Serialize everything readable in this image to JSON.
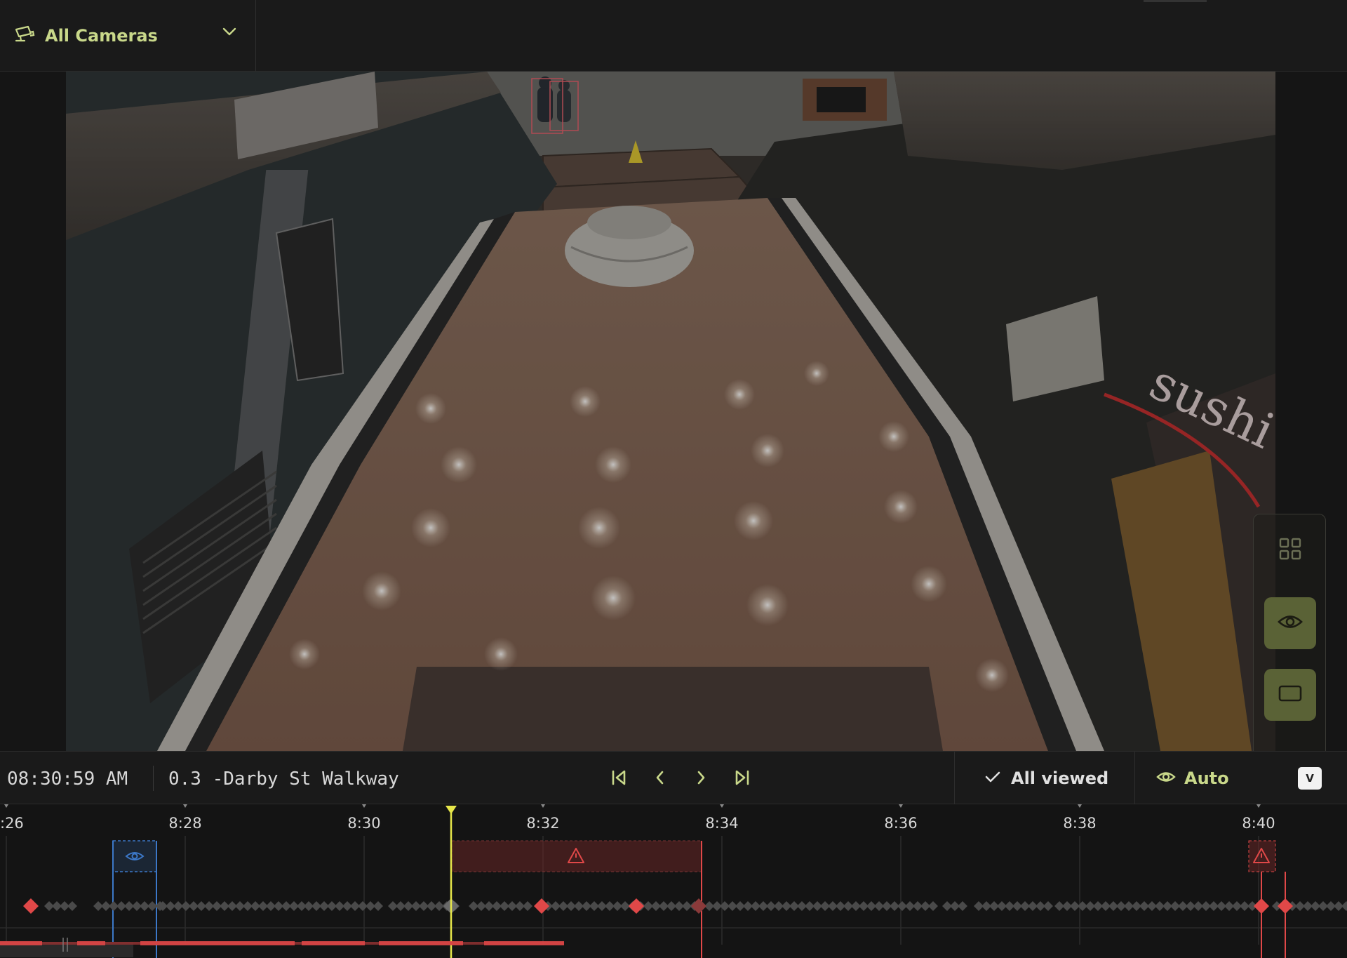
{
  "camera_selector": {
    "label": "All Cameras",
    "icon": "cctv-camera-icon",
    "chevron": "chevron-down-icon"
  },
  "side_tools": [
    {
      "name": "grid-view-icon",
      "active": false
    },
    {
      "name": "eye-icon",
      "active": true
    },
    {
      "name": "single-view-icon",
      "active": true
    },
    {
      "name": "download-icon",
      "active": false
    }
  ],
  "controls": {
    "time": "08:30:59 AM",
    "camera_name": "0.3 -Darby St Walkway",
    "nav": [
      "skip-back-icon",
      "previous-icon",
      "next-icon",
      "skip-forward-icon"
    ],
    "viewed_label": "All viewed",
    "auto_label": "Auto",
    "shortcut_key": "V"
  },
  "timeline": {
    "tick_labels": [
      ":26",
      "8:28",
      "8:30",
      "8:32",
      "8:34",
      "8:36",
      "8:38",
      "8:40"
    ],
    "playhead_time": "8:31",
    "accent_color": "#e6e64a",
    "alert_color": "#e04848",
    "view_color": "#3c78c8"
  }
}
